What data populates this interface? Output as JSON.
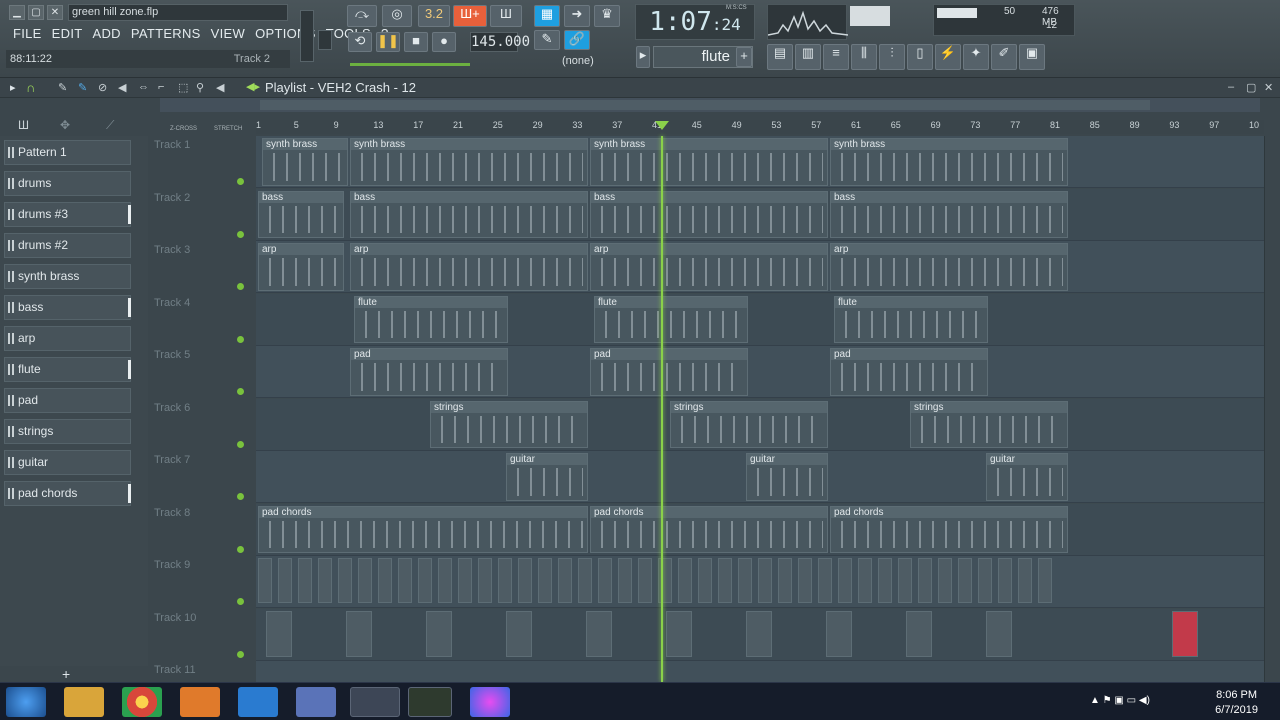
{
  "window": {
    "filename": "green hill zone.flp"
  },
  "menu": [
    "FILE",
    "EDIT",
    "ADD",
    "PATTERNS",
    "VIEW",
    "OPTIONS",
    "TOOLS",
    "?"
  ],
  "hint": {
    "time": "88:11:22",
    "track": "Track 2"
  },
  "transport": {
    "time_main": "1:07",
    "time_small": ":24",
    "time_mode": "M:S:CS",
    "tempo": "145.000",
    "pattern_snap": "3.2",
    "pattern": "(none)",
    "instrument": "flute"
  },
  "cpu": {
    "value": "50",
    "mem": "476 MB",
    "poly": "12"
  },
  "playlist": {
    "title": "Playlist - VEH2 Crash - 12",
    "crossfade_label": "Z-CROSS",
    "stretch_label": "STRETCH",
    "ruler": [
      "1",
      "5",
      "9",
      "13",
      "17",
      "21",
      "25",
      "29",
      "33",
      "37",
      "41",
      "45",
      "49",
      "53",
      "57",
      "61",
      "65",
      "69",
      "73",
      "77",
      "81",
      "85",
      "89",
      "93",
      "97",
      "10"
    ],
    "patterns": [
      {
        "label": "Pattern 1",
        "selected": false
      },
      {
        "label": "drums",
        "selected": false
      },
      {
        "label": "drums #3",
        "selected": true
      },
      {
        "label": "drums #2",
        "selected": false
      },
      {
        "label": "synth brass",
        "selected": false
      },
      {
        "label": "bass",
        "selected": true
      },
      {
        "label": "arp",
        "selected": false
      },
      {
        "label": "flute",
        "selected": true
      },
      {
        "label": "pad",
        "selected": false
      },
      {
        "label": "strings",
        "selected": false
      },
      {
        "label": "guitar",
        "selected": false
      },
      {
        "label": "pad chords",
        "selected": true
      }
    ],
    "tracks": [
      "Track 1",
      "Track 2",
      "Track 3",
      "Track 4",
      "Track 5",
      "Track 6",
      "Track 7",
      "Track 8",
      "Track 9",
      "Track 10",
      "Track 11"
    ],
    "clips": [
      {
        "track": 0,
        "label": "synth brass",
        "start": 1,
        "len": 22
      },
      {
        "track": 0,
        "label": "synth brass",
        "start": 23,
        "len": 60
      },
      {
        "track": 0,
        "label": "synth brass",
        "start": 83,
        "len": 60
      },
      {
        "track": 0,
        "label": "synth brass",
        "start": 143,
        "len": 60
      },
      {
        "track": 1,
        "label": "bass",
        "start": 0,
        "len": 22
      },
      {
        "track": 1,
        "label": "bass",
        "start": 23,
        "len": 60
      },
      {
        "track": 1,
        "label": "bass",
        "start": 83,
        "len": 60
      },
      {
        "track": 1,
        "label": "bass",
        "start": 143,
        "len": 60
      },
      {
        "track": 2,
        "label": "arp",
        "start": 0,
        "len": 22
      },
      {
        "track": 2,
        "label": "arp",
        "start": 23,
        "len": 60
      },
      {
        "track": 2,
        "label": "arp",
        "start": 83,
        "len": 60
      },
      {
        "track": 2,
        "label": "arp",
        "start": 143,
        "len": 60
      },
      {
        "track": 3,
        "label": "flute",
        "start": 24,
        "len": 39
      },
      {
        "track": 3,
        "label": "flute",
        "start": 84,
        "len": 39
      },
      {
        "track": 3,
        "label": "flute",
        "start": 144,
        "len": 39
      },
      {
        "track": 4,
        "label": "pad",
        "start": 23,
        "len": 40
      },
      {
        "track": 4,
        "label": "pad",
        "start": 83,
        "len": 40
      },
      {
        "track": 4,
        "label": "pad",
        "start": 143,
        "len": 40
      },
      {
        "track": 5,
        "label": "strings",
        "start": 43,
        "len": 40
      },
      {
        "track": 5,
        "label": "strings",
        "start": 103,
        "len": 40
      },
      {
        "track": 5,
        "label": "strings",
        "start": 163,
        "len": 40
      },
      {
        "track": 6,
        "label": "guitar",
        "start": 62,
        "len": 21
      },
      {
        "track": 6,
        "label": "guitar",
        "start": 122,
        "len": 21
      },
      {
        "track": 6,
        "label": "guitar",
        "start": 182,
        "len": 21
      },
      {
        "track": 7,
        "label": "pad chords",
        "start": 0,
        "len": 83
      },
      {
        "track": 7,
        "label": "pad chords",
        "start": 83,
        "len": 60
      },
      {
        "track": 7,
        "label": "pad chords",
        "start": 143,
        "len": 60
      }
    ]
  },
  "taskbar": {
    "time": "8:06 PM",
    "date": "6/7/2019"
  }
}
